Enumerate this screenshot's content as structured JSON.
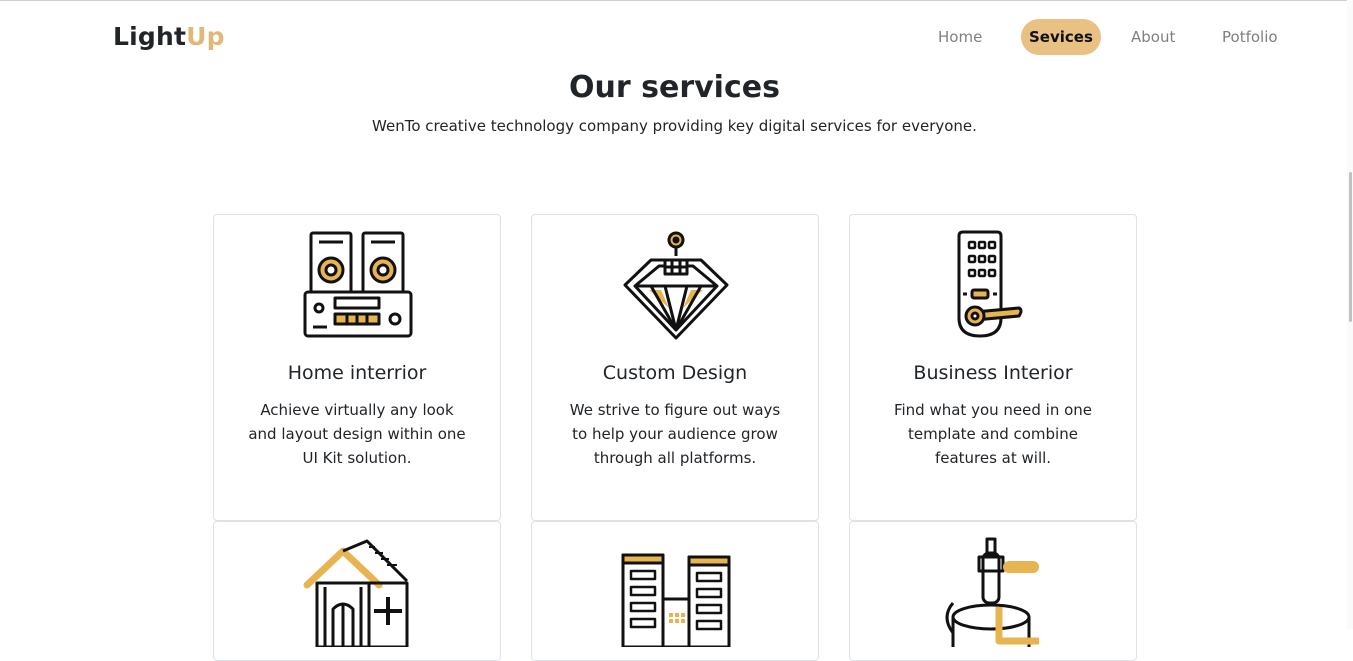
{
  "brand": {
    "part1": "Light",
    "part2": "Up",
    "accent_color": "#e0b978"
  },
  "nav": {
    "items": [
      {
        "label": "Home"
      },
      {
        "label": "Sevices",
        "active": true
      },
      {
        "label": "About"
      },
      {
        "label": "Potfolio"
      }
    ]
  },
  "section": {
    "title": "Our services",
    "subtitle": "WenTo creative technology company providing key digital services for everyone."
  },
  "cards": [
    {
      "icon": "speaker-stereo-icon",
      "title": "Home interrior",
      "description": "Achieve virtually any look and layout design within one UI Kit solution."
    },
    {
      "icon": "diamond-icon",
      "title": "Custom Design",
      "description": "We strive to figure out ways to help your audience grow through all platforms."
    },
    {
      "icon": "door-lock-keypad-icon",
      "title": "Business Interior",
      "description": "Find what you need in one template and combine features at will."
    },
    {
      "icon": "house-icon",
      "title": "",
      "description": ""
    },
    {
      "icon": "buildings-icon",
      "title": "",
      "description": ""
    },
    {
      "icon": "faucet-icon",
      "title": "",
      "description": ""
    }
  ]
}
